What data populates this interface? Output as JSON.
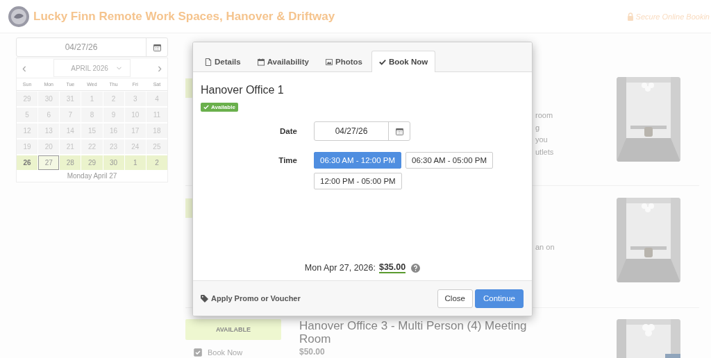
{
  "header": {
    "title": "Lucky Finn Remote Work Spaces, Hanover & Driftway",
    "secure_label": "Secure Online Bookin"
  },
  "calendar": {
    "date_value": "04/27/26",
    "month_label": "APRIL 2026",
    "prev": "‹",
    "next": "›",
    "weekdays": [
      "Sun",
      "Mon",
      "Tue",
      "Wed",
      "Thu",
      "Fri",
      "Sat"
    ],
    "days": [
      {
        "label": "29",
        "available": false,
        "selected": false,
        "today": false
      },
      {
        "label": "30",
        "available": false,
        "selected": false,
        "today": false
      },
      {
        "label": "31",
        "available": false,
        "selected": false,
        "today": false
      },
      {
        "label": "1",
        "available": false,
        "selected": false,
        "today": false
      },
      {
        "label": "2",
        "available": false,
        "selected": false,
        "today": false
      },
      {
        "label": "3",
        "available": false,
        "selected": false,
        "today": false
      },
      {
        "label": "4",
        "available": false,
        "selected": false,
        "today": false
      },
      {
        "label": "5",
        "available": false,
        "selected": false,
        "today": false
      },
      {
        "label": "6",
        "available": false,
        "selected": false,
        "today": false
      },
      {
        "label": "7",
        "available": false,
        "selected": false,
        "today": false
      },
      {
        "label": "8",
        "available": false,
        "selected": false,
        "today": false
      },
      {
        "label": "9",
        "available": false,
        "selected": false,
        "today": false
      },
      {
        "label": "10",
        "available": false,
        "selected": false,
        "today": false
      },
      {
        "label": "11",
        "available": false,
        "selected": false,
        "today": false
      },
      {
        "label": "12",
        "available": false,
        "selected": false,
        "today": false
      },
      {
        "label": "13",
        "available": false,
        "selected": false,
        "today": false
      },
      {
        "label": "14",
        "available": false,
        "selected": false,
        "today": false
      },
      {
        "label": "15",
        "available": false,
        "selected": false,
        "today": false
      },
      {
        "label": "16",
        "available": false,
        "selected": false,
        "today": false
      },
      {
        "label": "17",
        "available": false,
        "selected": false,
        "today": false
      },
      {
        "label": "18",
        "available": false,
        "selected": false,
        "today": false
      },
      {
        "label": "19",
        "available": false,
        "selected": false,
        "today": false
      },
      {
        "label": "20",
        "available": false,
        "selected": false,
        "today": false
      },
      {
        "label": "21",
        "available": false,
        "selected": false,
        "today": false
      },
      {
        "label": "22",
        "available": false,
        "selected": false,
        "today": false
      },
      {
        "label": "23",
        "available": false,
        "selected": false,
        "today": false
      },
      {
        "label": "24",
        "available": false,
        "selected": false,
        "today": false
      },
      {
        "label": "25",
        "available": false,
        "selected": false,
        "today": false
      },
      {
        "label": "26",
        "available": true,
        "selected": false,
        "today": true
      },
      {
        "label": "27",
        "available": true,
        "selected": true,
        "today": false
      },
      {
        "label": "28",
        "available": true,
        "selected": false,
        "today": false
      },
      {
        "label": "29",
        "available": true,
        "selected": false,
        "today": false
      },
      {
        "label": "30",
        "available": true,
        "selected": false,
        "today": false
      },
      {
        "label": "1",
        "available": true,
        "selected": false,
        "today": false
      },
      {
        "label": "2",
        "available": true,
        "selected": false,
        "today": false
      }
    ],
    "footer": "Monday April 27"
  },
  "listings": [
    {
      "fragments": [
        "room",
        "g",
        "you",
        "utlets"
      ],
      "picture": {
        "kind": "picture"
      }
    },
    {
      "fragments": [
        "an on"
      ],
      "picture": {
        "kind": "picture"
      }
    },
    {
      "status": "AVAILABLE",
      "book_label": "Book Now",
      "book_checked": true,
      "title": "Hanover Office 3 - Multi Person (4) Meeting Room",
      "price": "$50.00",
      "picture": {
        "kind": "picture"
      }
    }
  ],
  "modal": {
    "tabs": [
      {
        "label": "Details",
        "selected": false
      },
      {
        "label": "Availability",
        "selected": false
      },
      {
        "label": "Photos",
        "selected": false
      },
      {
        "label": "Book Now",
        "selected": true
      }
    ],
    "title": "Hanover Office 1",
    "badge": "Available",
    "date_label": "Date",
    "date_value": "04/27/26",
    "time_label": "Time",
    "times": [
      {
        "label": "06:30 AM - 12:00 PM",
        "selected": true
      },
      {
        "label": "06:30 AM - 05:00 PM",
        "selected": false
      },
      {
        "label": "12:00 PM - 05:00 PM",
        "selected": false
      }
    ],
    "price_date": "Mon Apr 27, 2026:",
    "price": "$35.00",
    "promo": "Apply Promo or Voucher",
    "buttons": [
      {
        "label": "Close",
        "kind": "default"
      },
      {
        "label": "Continue",
        "kind": "primary"
      }
    ]
  }
}
